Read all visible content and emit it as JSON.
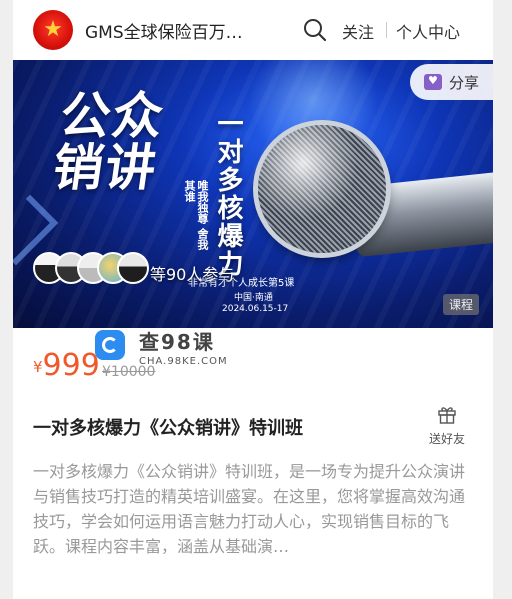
{
  "header": {
    "shop_title": "GMS全球保险百万…",
    "follow_label": "关注",
    "center_label": "个人中心"
  },
  "banner": {
    "main_slogan": "公众销讲",
    "side_slogan": "唯我独尊 舍我其谁",
    "vertical_title": "一对多核爆力",
    "subtitle": "非常有才个人成长第5课",
    "location": "中国·南通",
    "date": "2024.06.15-17",
    "share_label": "分享",
    "participants_text": "等90人参与",
    "course_tag": "课程"
  },
  "watermark": {
    "text": "查98课",
    "domain": "CHA.98KE.COM"
  },
  "price": {
    "currency": "¥",
    "value": "999",
    "original": "¥10000",
    "color": "#f05a2b"
  },
  "course": {
    "title": "一对多核爆力《公众销讲》特训班",
    "gift_label": "送好友",
    "description": "一对多核爆力《公众销讲》特训班，是一场专为提升公众演讲与销售技巧打造的精英培训盛宴。在这里，您将掌握高效沟通技巧，学会如何运用语言魅力打动人心，实现销售目标的飞跃。课程内容丰富，涵盖从基础演…"
  }
}
